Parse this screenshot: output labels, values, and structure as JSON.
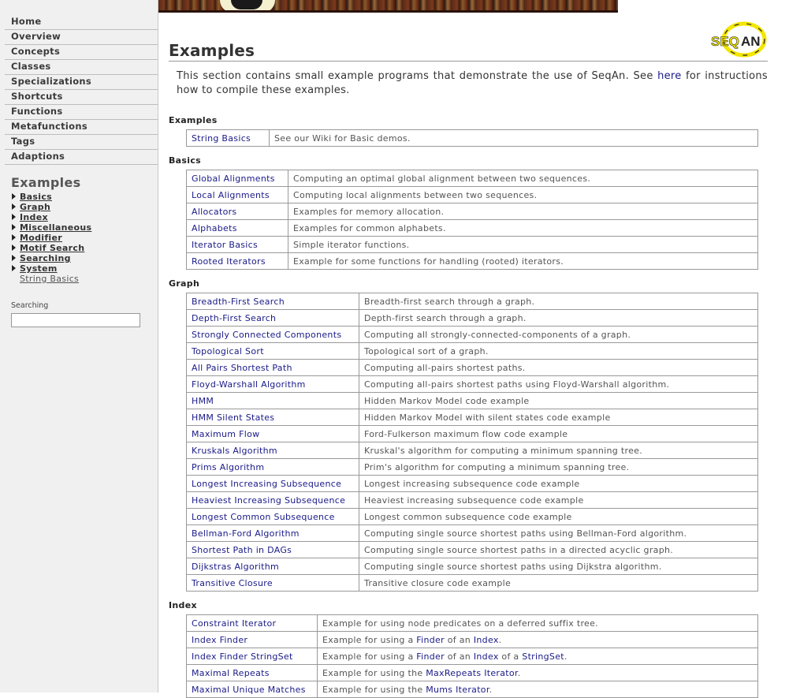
{
  "sidebar": {
    "nav": [
      "Home",
      "Overview",
      "Concepts",
      "Classes",
      "Specializations",
      "Shortcuts",
      "Functions",
      "Metafunctions",
      "Tags",
      "Adaptions"
    ],
    "heading": "Examples",
    "sub": [
      "Basics",
      "Graph",
      "Index",
      "Miscellaneous",
      "Modifier",
      "Motif Search",
      "Searching",
      "System"
    ],
    "leaf": "String Basics",
    "search_label": "Searching",
    "search_value": ""
  },
  "logo": {
    "text": "SEQAN",
    "colors": [
      "#f3e600",
      "#222222"
    ]
  },
  "page": {
    "title": "Examples",
    "intro_pre": "This section contains small example programs that demonstrate the use of SeqAn. See ",
    "intro_link": "here",
    "intro_post": " for instructions how to compile these examples."
  },
  "sections": [
    {
      "title": "Examples",
      "col1": 92,
      "rows": [
        {
          "name": "String Basics",
          "desc": "See our Wiki for Basic demos."
        }
      ]
    },
    {
      "title": "Basics",
      "col1": 116,
      "rows": [
        {
          "name": "Global Alignments",
          "desc": "Computing an optimal global alignment between two sequences."
        },
        {
          "name": "Local Alignments",
          "desc": "Computing local alignments between two sequences."
        },
        {
          "name": "Allocators",
          "desc": "Examples for memory allocation."
        },
        {
          "name": "Alphabets",
          "desc": "Examples for common alphabets."
        },
        {
          "name": "Iterator Basics",
          "desc": "Simple iterator functions."
        },
        {
          "name": "Rooted Iterators",
          "desc": "Example for some functions for handling (rooted) iterators."
        }
      ]
    },
    {
      "title": "Graph",
      "col1": 206,
      "rows": [
        {
          "name": "Breadth-First Search",
          "desc": "Breadth-first search through a graph."
        },
        {
          "name": "Depth-First Search",
          "desc": "Depth-first search through a graph."
        },
        {
          "name": "Strongly Connected Components",
          "desc": "Computing all strongly-connected-components of a graph."
        },
        {
          "name": "Topological Sort",
          "desc": "Topological sort of a graph."
        },
        {
          "name": "All Pairs Shortest Path",
          "desc": "Computing all-pairs shortest paths."
        },
        {
          "name": "Floyd-Warshall Algorithm",
          "desc": "Computing all-pairs shortest paths using Floyd-Warshall algorithm."
        },
        {
          "name": "HMM",
          "desc": "Hidden Markov Model code example"
        },
        {
          "name": "HMM Silent States",
          "desc": "Hidden Markov Model with silent states code example"
        },
        {
          "name": "Maximum Flow",
          "desc": "Ford-Fulkerson maximum flow code example"
        },
        {
          "name": "Kruskals Algorithm",
          "desc": "Kruskal's algorithm for computing a minimum spanning tree."
        },
        {
          "name": "Prims Algorithm",
          "desc": "Prim's algorithm for computing a minimum spanning tree."
        },
        {
          "name": "Longest Increasing Subsequence",
          "desc": "Longest increasing subsequence code example"
        },
        {
          "name": "Heaviest Increasing Subsequence",
          "desc": "Heaviest increasing subsequence code example"
        },
        {
          "name": "Longest Common Subsequence",
          "desc": "Longest common subsequence code example"
        },
        {
          "name": "Bellman-Ford Algorithm",
          "desc": "Computing single source shortest paths using Bellman-Ford algorithm."
        },
        {
          "name": "Shortest Path in DAGs",
          "desc": "Computing single source shortest paths in a directed acyclic graph."
        },
        {
          "name": "Dijkstras Algorithm",
          "desc": "Computing single source shortest paths using Dijkstra algorithm."
        },
        {
          "name": "Transitive Closure",
          "desc": "Transitive closure code example"
        }
      ]
    },
    {
      "title": "Index",
      "col1": 153,
      "rows": [
        {
          "name": "Constraint Iterator",
          "desc": [
            {
              "t": "Example for using node predicates on a deferred suffix tree."
            }
          ]
        },
        {
          "name": "Index Finder",
          "desc": [
            {
              "t": "Example for using a "
            },
            {
              "t": "Finder",
              "link": true
            },
            {
              "t": " of an "
            },
            {
              "t": "Index",
              "link": true
            },
            {
              "t": "."
            }
          ]
        },
        {
          "name": "Index Finder StringSet",
          "desc": [
            {
              "t": "Example for using a "
            },
            {
              "t": "Finder",
              "link": true
            },
            {
              "t": " of an "
            },
            {
              "t": "Index",
              "link": true
            },
            {
              "t": " of a "
            },
            {
              "t": "StringSet",
              "link": true
            },
            {
              "t": "."
            }
          ]
        },
        {
          "name": "Maximal Repeats",
          "desc": [
            {
              "t": "Example for using the "
            },
            {
              "t": "MaxRepeats Iterator",
              "link": true
            },
            {
              "t": "."
            }
          ]
        },
        {
          "name": "Maximal Unique Matches",
          "desc": [
            {
              "t": "Example for using the "
            },
            {
              "t": "Mums Iterator",
              "link": true
            },
            {
              "t": "."
            }
          ]
        }
      ]
    }
  ]
}
